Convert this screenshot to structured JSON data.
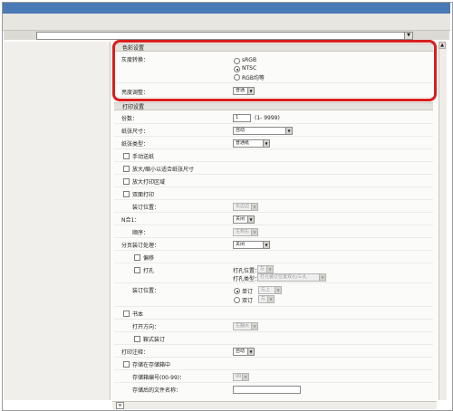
{
  "address": {
    "value": ""
  },
  "color_section": {
    "title": "色彩设置",
    "gray_label": "灰度转换：",
    "gray_options": [
      "sRGB",
      "NTSC",
      "RGB均等"
    ],
    "gray_selected": "NTSC",
    "density_label": "亮度调整：",
    "density_value": "普通"
  },
  "print_section": {
    "title": "打印设置",
    "copies_label": "份数：",
    "copies_value": "1",
    "copies_range": "(1- 9999)",
    "paper_size_label": "纸张尺寸：",
    "paper_size_value": "自动",
    "paper_type_label": "纸张类型：",
    "paper_type_value": "普通纸",
    "manual_feed": "手动送纸",
    "fit_paper": "放大/缩小以适合纸张尺寸",
    "enlarge_area": "放大打印区域",
    "duplex": "双面打印",
    "binding_pos_label": "装订位置：",
    "binding_pos_value": "长边边",
    "nup_label": "N合1：",
    "nup_value": "关闭",
    "page_order_label": "顺序：",
    "page_order_value": "左到右",
    "finishing_label": "分页装订处理：",
    "finishing_value": "关闭",
    "offset": "偏移",
    "punch": "打孔",
    "punch_pos_label": "打孔位置：",
    "punch_pos_value": "左",
    "punch_type_label": "打孔类型：",
    "punch_type_value": "打孔装订位置双孔/三孔",
    "staple_pos_label": "装订位置：",
    "staple_single": "单订",
    "staple_single_value": "左上",
    "staple_double": "双订",
    "staple_double_value": "左",
    "booklet": "书本",
    "open_dir_label": "打开方向：",
    "open_dir_value": "左翻页",
    "saddle_stitch": "鞍式装订",
    "annotation_label": "打印注释：",
    "annotation_value": "自动",
    "store_box": "存储在存储箱中",
    "box_number_label": "存储箱编号(00-99)：",
    "box_number_value": "00",
    "store_filename_label": "存储后的文件名称：",
    "store_filename_value": ""
  }
}
